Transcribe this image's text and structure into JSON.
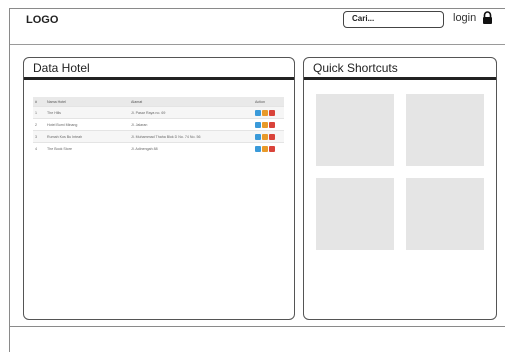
{
  "header": {
    "logo": "LOGO",
    "search_placeholder": "Cari...",
    "login_label": "login"
  },
  "data_panel": {
    "title": "Data Hotel",
    "table": {
      "columns": [
        "#",
        "Nama Hotel",
        "Alamat",
        "Action"
      ],
      "rows": [
        [
          "1",
          "The Hills",
          "Jl. Pasar Raya no. 69",
          ""
        ],
        [
          "2",
          "Hotel Bumi Minang",
          "Jl. Jalaran",
          ""
        ],
        [
          "3",
          "Rumah Kos Bu Inteah",
          "Jl. Muhammad Thaha Blok D No. 74 No. 56",
          ""
        ],
        [
          "4",
          "The Book Store",
          "Jl. Adinengah 88",
          ""
        ]
      ]
    }
  },
  "shortcuts_panel": {
    "title": "Quick Shortcuts",
    "tiles": 4
  },
  "colors": {
    "view_button": "#3a9ad9",
    "edit_button": "#e89a2a",
    "delete_button": "#d9433a",
    "tile": "#e5e5e5"
  }
}
